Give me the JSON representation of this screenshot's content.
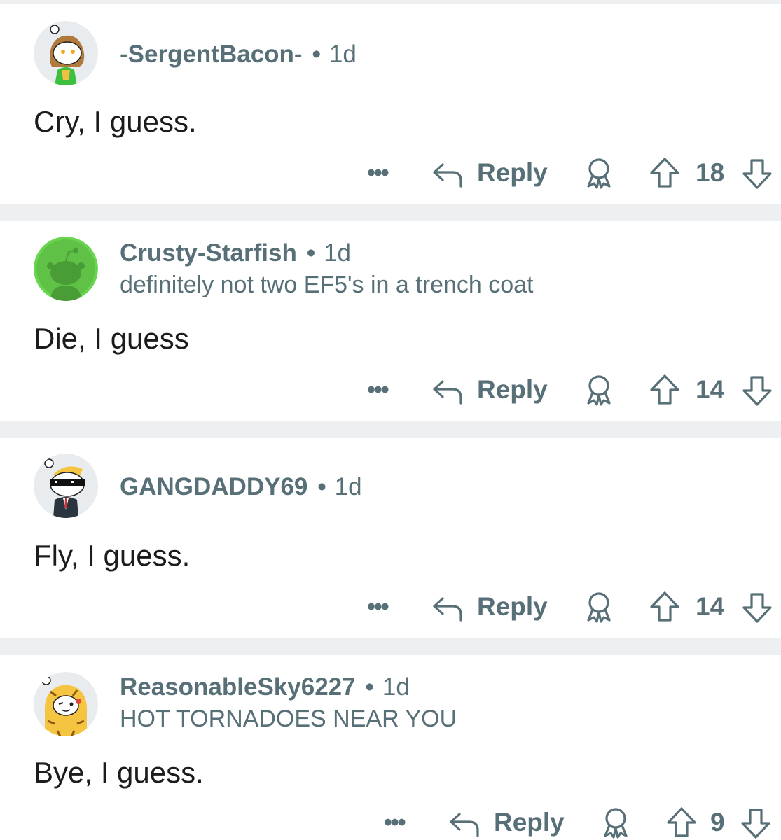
{
  "comments": [
    {
      "username": "-SergentBacon-",
      "separator": "•",
      "age": "1d",
      "flair": "",
      "body": "Cry, I guess.",
      "more_label": "•••",
      "reply_label": "Reply",
      "score": "18",
      "avatar_icon": "avatar-brown-hair-green-shirt-icon"
    },
    {
      "username": "Crusty-Starfish",
      "separator": "•",
      "age": "1d",
      "flair": "definitely not two EF5's in a trench coat",
      "body": "Die, I guess",
      "more_label": "•••",
      "reply_label": "Reply",
      "score": "14",
      "avatar_icon": "avatar-default-snoo-green-icon"
    },
    {
      "username": "GANGDADDY69",
      "separator": "•",
      "age": "1d",
      "flair": "",
      "body": "Fly, I guess.",
      "more_label": "•••",
      "reply_label": "Reply",
      "score": "14",
      "avatar_icon": "avatar-snoo-sunglasses-suit-icon"
    },
    {
      "username": "ReasonableSky6227",
      "separator": "•",
      "age": "1d",
      "flair": "HOT TORNADOES NEAR YOU",
      "body": "Bye, I guess.",
      "more_label": "•••",
      "reply_label": "Reply",
      "score": "9",
      "avatar_icon": "avatar-tiger-costume-icon"
    }
  ],
  "icons": {
    "more": "more-options-icon",
    "reply": "reply-arrow-icon",
    "award": "award-icon",
    "upvote": "upvote-arrow-icon",
    "downvote": "downvote-arrow-icon"
  },
  "colors": {
    "background_separator": "#edeff1",
    "card": "#ffffff",
    "meta_text": "#576f76",
    "body_text": "#1c1c1c",
    "snoo_green": "#6ad64f"
  }
}
